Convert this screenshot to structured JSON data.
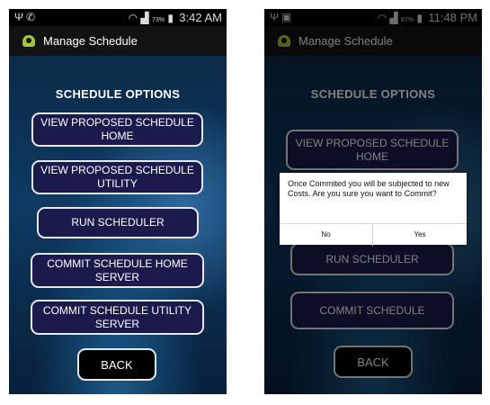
{
  "status_left": {
    "icons": [
      "usb-icon",
      "whatsapp-icon"
    ],
    "wifi_icon": "wifi-icon",
    "signal_icon": "signal-icon",
    "battery_percent": "73%",
    "battery_icon": "battery-icon",
    "time": "3:42 AM"
  },
  "status_right": {
    "icons": [
      "usb-icon",
      "image-icon"
    ],
    "wifi_icon": "wifi-icon",
    "signal_icon": "signal-icon",
    "battery_percent": "87%",
    "battery_icon": "battery-icon",
    "time": "11:48 PM"
  },
  "app": {
    "title": "Manage Schedule",
    "icon": "android-icon"
  },
  "left_screen": {
    "heading": "SCHEDULE OPTIONS",
    "buttons": {
      "view_home": "VIEW PROPOSED SCHEDULE HOME",
      "view_utility": "VIEW PROPOSED SCHEDULE UTILITY",
      "run": "RUN SCHEDULER",
      "commit_home": "COMMIT SCHEDULE HOME SERVER",
      "commit_utility": "COMMIT SCHEDULE UTILITY SERVER",
      "back": "BACK"
    }
  },
  "right_screen": {
    "heading": "SCHEDULE OPTIONS",
    "buttons": {
      "view_home": "VIEW PROPOSED SCHEDULE HOME",
      "run_partial": "RUN SCHEDULER",
      "commit": "COMMIT SCHEDULE",
      "back": "BACK"
    },
    "dialog": {
      "message": "Once Commited you will be subjected to new Costs. Are you sure you want to Commit?",
      "no": "No",
      "yes": "Yes"
    }
  },
  "colors": {
    "button_fill": "#1b1a4c",
    "button_border": "#e8e8e8",
    "status_bar": "#000000",
    "action_bar": "#121212",
    "background_blue": "#0e3a62"
  }
}
